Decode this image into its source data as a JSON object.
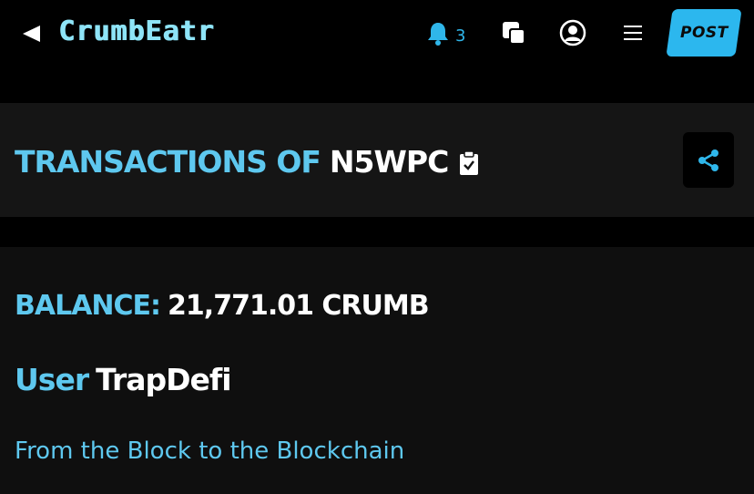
{
  "app": {
    "name": "CrumbEatr"
  },
  "topbar": {
    "notifications_count": "3",
    "post_label": "POST",
    "icons": {
      "back": "back-triangle-icon",
      "bell": "bell-icon",
      "windows": "overlapping-squares-icon",
      "account": "user-circle-icon",
      "menu": "hamburger-menu-icon"
    }
  },
  "header": {
    "title_prefix": "TRANSACTIONS OF",
    "address": "N5WPC",
    "copy_icon": "clipboard-check-icon",
    "share_icon": "share-icon"
  },
  "info": {
    "balance_label": "BALANCE:",
    "balance_value": "21,771.01 CRUMB",
    "user_label": "User",
    "user_name": "TrapDefi",
    "tagline": "From the Block to the Blockchain"
  },
  "colors": {
    "accent": "#5ec8ef",
    "logo": "#8ee4f7",
    "button": "#2cb7ee",
    "bell": "#2fb6ea",
    "background": "#000000",
    "panel": "#151515"
  }
}
